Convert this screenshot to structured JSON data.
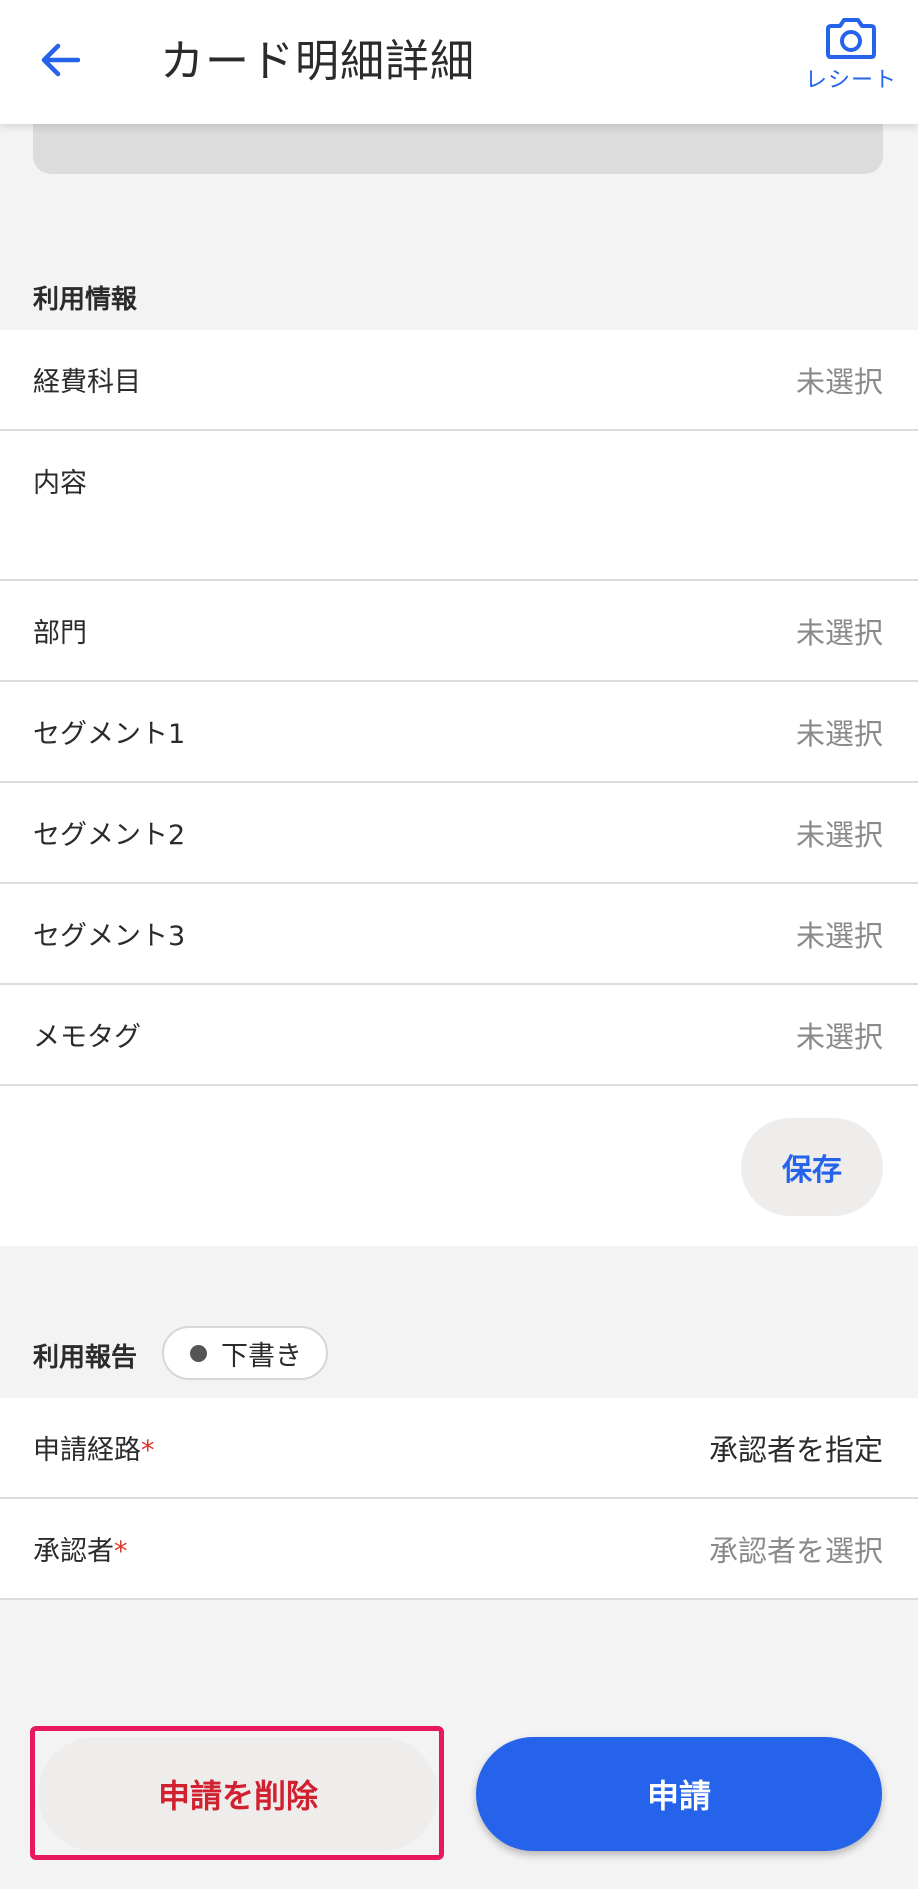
{
  "header": {
    "title": "カード明細詳細",
    "receipt_label": "レシート"
  },
  "usage_info": {
    "section_label": "利用情報",
    "rows": [
      {
        "label": "経費科目",
        "value": "未選択"
      },
      {
        "label": "内容",
        "value": ""
      },
      {
        "label": "部門",
        "value": "未選択"
      },
      {
        "label": "セグメント1",
        "value": "未選択"
      },
      {
        "label": "セグメント2",
        "value": "未選択"
      },
      {
        "label": "セグメント3",
        "value": "未選択"
      },
      {
        "label": "メモタグ",
        "value": "未選択"
      }
    ],
    "save_label": "保存"
  },
  "usage_report": {
    "section_label": "利用報告",
    "status": "下書き",
    "rows": [
      {
        "label": "申請経路",
        "value": "承認者を指定",
        "required_mark": "*"
      },
      {
        "label": "承認者",
        "value": "承認者を選択",
        "required_mark": "*"
      }
    ]
  },
  "footer": {
    "delete_label": "申請を削除",
    "apply_label": "申請"
  },
  "colors": {
    "accent": "#2563eb",
    "danger": "#d12130",
    "highlight": "#e8185e",
    "required": "#e1342a"
  },
  "icons": {
    "back": "arrow-left-icon",
    "receipt": "camera-icon",
    "status": "dot-icon"
  }
}
